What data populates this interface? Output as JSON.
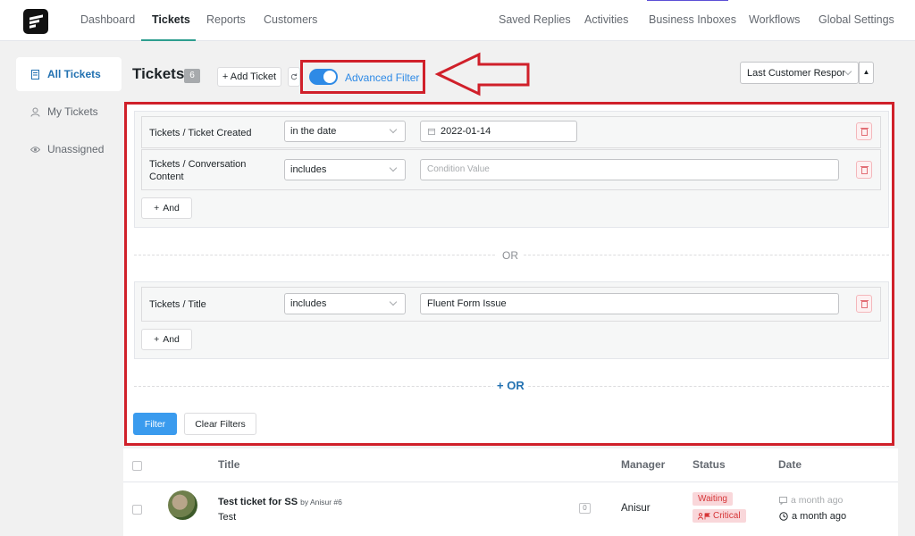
{
  "nav": {
    "logo": "fluent-support-logo",
    "items": [
      {
        "label": "Dashboard"
      },
      {
        "label": "Tickets"
      },
      {
        "label": "Reports"
      },
      {
        "label": "Customers"
      }
    ],
    "right_items": [
      {
        "label": "Saved Replies"
      },
      {
        "label": "Activities"
      },
      {
        "label": "Business Inboxes"
      },
      {
        "label": "Workflows"
      },
      {
        "label": "Global Settings"
      }
    ],
    "active": "Tickets",
    "accent_color": "#2e9e8f"
  },
  "sidebar": {
    "items": [
      {
        "label": "All Tickets",
        "icon": "ticket-icon",
        "active": true
      },
      {
        "label": "My Tickets",
        "icon": "user-icon"
      },
      {
        "label": "Unassigned",
        "icon": "eye-icon"
      }
    ]
  },
  "header": {
    "title": "Tickets",
    "count": "6",
    "add_ticket_label": "+ Add Ticket",
    "advanced_filter_label": "Advanced Filter",
    "advanced_filter_on": true,
    "sort_by": "Last Customer Respor",
    "sort_dir_icon": "caret-up-icon"
  },
  "filters": {
    "group1": [
      {
        "field": "Tickets / Ticket Created",
        "operator": "in the date",
        "value": "2022-01-14",
        "placeholder": ""
      },
      {
        "field": "Tickets / Conversation Content",
        "operator": "includes",
        "value": "",
        "placeholder": "Condition Value"
      }
    ],
    "group2": [
      {
        "field": "Tickets / Title",
        "operator": "includes",
        "value": "Fluent Form Issue",
        "placeholder": ""
      }
    ],
    "and_label": "And",
    "or_label": "OR",
    "add_or_label": "OR",
    "filter_button": "Filter",
    "clear_button": "Clear Filters"
  },
  "table": {
    "columns": [
      "Title",
      "Manager",
      "Status",
      "Date"
    ],
    "rows": [
      {
        "title": "Test ticket for SS",
        "meta": "by Anisur #6",
        "subtitle": "Test",
        "replies": "0",
        "manager": "Anisur",
        "status": "Waiting",
        "priority": "Critical",
        "updated": "a month ago",
        "created": "a month ago"
      }
    ]
  },
  "annotation_color": "#d0202a"
}
